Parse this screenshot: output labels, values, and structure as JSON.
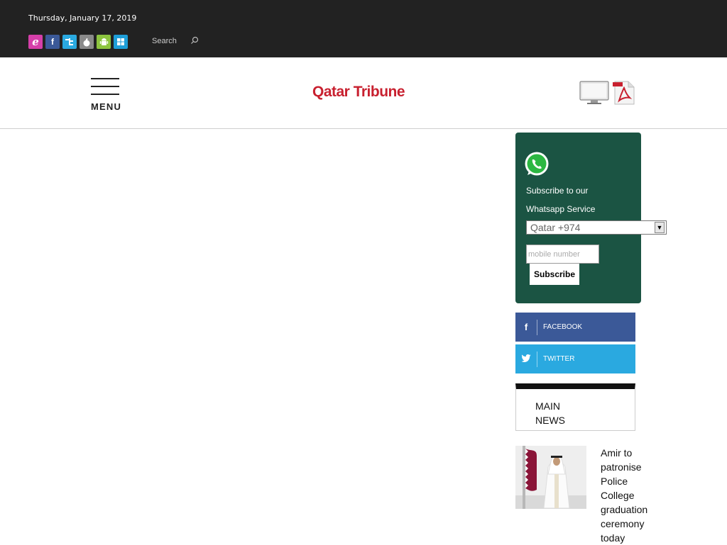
{
  "topbar": {
    "date": "Thursday, January 17, 2019",
    "social_icons": [
      "e-paper-icon",
      "facebook-icon",
      "twitter-icon",
      "apple-icon",
      "android-icon",
      "windows-icon"
    ],
    "search_label": "Search"
  },
  "header": {
    "menu_label": "MENU",
    "logo_text": "Qatar Tribune"
  },
  "whatsapp": {
    "line1": "Subscribe to our",
    "line2": "Whatsapp Service",
    "country_selected": "Qatar +974",
    "mobile_placeholder": "mobile number",
    "subscribe_label": "Subscribe"
  },
  "social_buttons": {
    "facebook_label": "FACEBOOK",
    "twitter_label": "TWITTER"
  },
  "main_news": {
    "title": "MAIN NEWS"
  },
  "stories": [
    {
      "title": "Amir to patronise Police College graduation ceremony today"
    }
  ],
  "colors": {
    "topbar_bg": "#222222",
    "brand_red": "#c8202f",
    "whatsapp_bg": "#1b5443",
    "facebook": "#3b5998",
    "twitter": "#2aa9e0"
  }
}
